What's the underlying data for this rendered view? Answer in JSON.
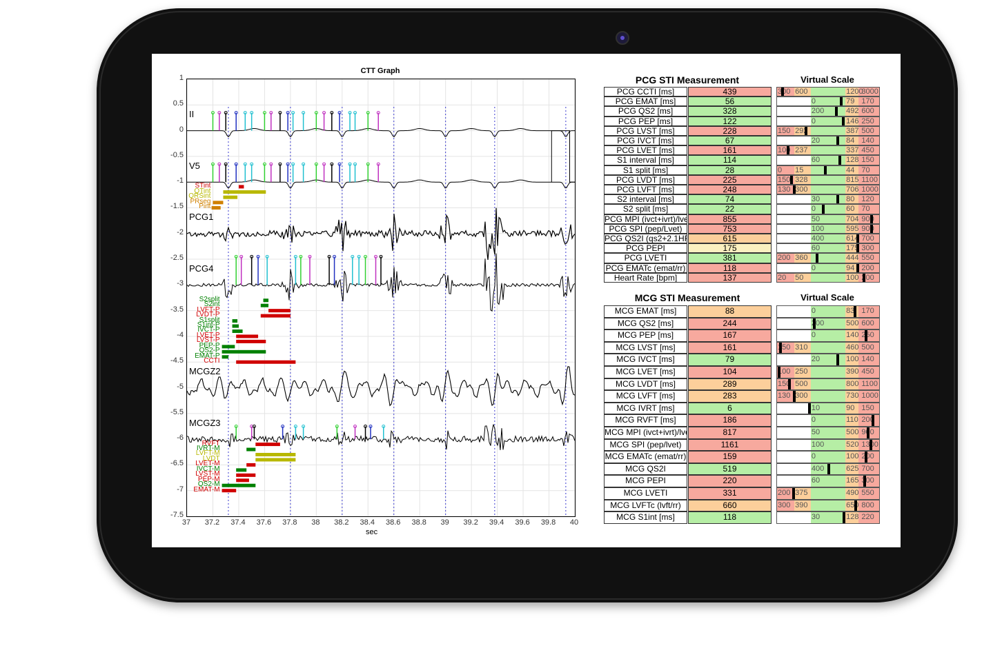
{
  "graph": {
    "title": "CTT Graph",
    "xlabel": "sec",
    "yticks": [
      "1",
      "0.5",
      "0",
      "-0.5",
      "-1",
      "-1.5",
      "-2",
      "-2.5",
      "-3",
      "-3.5",
      "-4",
      "-4.5",
      "-5",
      "-5.5",
      "-6",
      "-6.5",
      "-7",
      "-7.5"
    ],
    "xticks": [
      "37",
      "37.2",
      "37.4",
      "37.6",
      "37.8",
      "38",
      "38.2",
      "38.4",
      "38.6",
      "38.8",
      "39",
      "39.2",
      "39.4",
      "39.6",
      "39.8",
      "40"
    ],
    "signals": [
      "II",
      "V5",
      "PCG1",
      "PCG4",
      "MCGZ2",
      "MCGZ3"
    ],
    "ecg_markers": [
      "Pon",
      "Poff",
      "QRS",
      "Tp",
      "Toff",
      "Ton"
    ],
    "pcg_markers": [
      "S1",
      "S2",
      "S1s",
      "S2s",
      "S2p"
    ],
    "ecg_intervals": [
      {
        "label": "STint",
        "color": "#d00000"
      },
      {
        "label": "QTint",
        "color": "#b8b800"
      },
      {
        "label": "QRSint",
        "color": "#b8b800"
      },
      {
        "label": "PRseg",
        "color": "#d08000"
      },
      {
        "label": "Pint",
        "color": "#d08000"
      }
    ],
    "pcg_intervals": [
      {
        "label": "S2split",
        "color": "#008000"
      },
      {
        "label": "S2int",
        "color": "#008000"
      },
      {
        "label": "LVFT-P",
        "color": "#d00000"
      },
      {
        "label": "LVDT-P",
        "color": "#d00000"
      },
      {
        "label": "S1split",
        "color": "#008000"
      },
      {
        "label": "S1int-P",
        "color": "#008000"
      },
      {
        "label": "IVCT-P",
        "color": "#008000"
      },
      {
        "label": "LVET-P",
        "color": "#d00000"
      },
      {
        "label": "LVST-P",
        "color": "#d00000"
      },
      {
        "label": "PEP-P",
        "color": "#008000"
      },
      {
        "label": "QS2-P",
        "color": "#008000"
      },
      {
        "label": "EMAT-P",
        "color": "#008000"
      },
      {
        "label": "CCTI",
        "color": "#d00000"
      }
    ],
    "mcg_intervals": [
      {
        "label": "RVFT",
        "color": "#d00000"
      },
      {
        "label": "IVRT-M",
        "color": "#008000"
      },
      {
        "label": "LVFT-M",
        "color": "#b8b800"
      },
      {
        "label": "LVDT",
        "color": "#b8b800"
      },
      {
        "label": "LVET-M",
        "color": "#d00000"
      },
      {
        "label": "IVCT-M",
        "color": "#008000"
      },
      {
        "label": "LVST-M",
        "color": "#d00000"
      },
      {
        "label": "PEP-M",
        "color": "#d00000"
      },
      {
        "label": "QS2-M",
        "color": "#008000"
      },
      {
        "label": "EMAT-M",
        "color": "#d00000"
      }
    ],
    "mcg_markers": [
      "MC",
      "AO",
      "Ton",
      "AC",
      "MO"
    ]
  },
  "pcg_table": {
    "title": "PCG STI Measurement",
    "scale_title": "Virtual Scale",
    "rows": [
      {
        "name": "PCG CCTI [ms]",
        "value": "439",
        "color": "#f7a99e",
        "labels": [
          "300",
          "600",
          "1200",
          "3000"
        ],
        "marker": 0.04
      },
      {
        "name": "PCG EMAT [ms]",
        "value": "56",
        "color": "#b6eea5",
        "labels": [
          "0",
          "79",
          "170"
        ],
        "marker": 0.63
      },
      {
        "name": "PCG QS2 [ms]",
        "value": "328",
        "color": "#b6eea5",
        "labels": [
          "200",
          "492",
          "600"
        ],
        "marker": 0.58
      },
      {
        "name": "PCG PEP [ms]",
        "value": "122",
        "color": "#b6eea5",
        "labels": [
          "0",
          "146",
          "250"
        ],
        "marker": 0.65
      },
      {
        "name": "PCG LVST [ms]",
        "value": "228",
        "color": "#f7a99e",
        "labels": [
          "150",
          "292",
          "387",
          "500"
        ],
        "marker": 0.28
      },
      {
        "name": "PCG IVCT [ms]",
        "value": "67",
        "color": "#b6eea5",
        "labels": [
          "20",
          "84",
          "140"
        ],
        "marker": 0.6
      },
      {
        "name": "PCG LVET [ms]",
        "value": "161",
        "color": "#f7a99e",
        "labels": [
          "100",
          "237",
          "337",
          "450"
        ],
        "marker": 0.1
      },
      {
        "name": "S1 interval [ms]",
        "value": "114",
        "color": "#b6eea5",
        "labels": [
          "60",
          "128",
          "150"
        ],
        "marker": 0.62
      },
      {
        "name": "S1 split [ms]",
        "value": "28",
        "color": "#b6eea5",
        "labels": [
          "0",
          "15",
          "44",
          "70"
        ],
        "marker": 0.47
      },
      {
        "name": "PCG LVDT [ms]",
        "value": "225",
        "color": "#f7a99e",
        "labels": [
          "150",
          "328",
          "815",
          "1100"
        ],
        "marker": 0.13
      },
      {
        "name": "PCG LVFT [ms]",
        "value": "248",
        "color": "#f7a99e",
        "labels": [
          "130",
          "300",
          "706",
          "1000"
        ],
        "marker": 0.16
      },
      {
        "name": "S2 interval [ms]",
        "value": "74",
        "color": "#b6eea5",
        "labels": [
          "30",
          "80",
          "120"
        ],
        "marker": 0.6
      },
      {
        "name": "S2 split [ms]",
        "value": "22",
        "color": "#b6eea5",
        "labels": [
          "0",
          "60",
          "70"
        ],
        "marker": 0.45
      },
      {
        "name": "PCG MPI (ivct+ivrt)/lvet",
        "value": "855",
        "color": "#f7a99e",
        "labels": [
          "50",
          "704",
          "900"
        ],
        "marker": 0.94
      },
      {
        "name": "PCG SPI (pep/Lvet)",
        "value": "753",
        "color": "#f7a99e",
        "labels": [
          "100",
          "595",
          "900"
        ],
        "marker": 0.94
      },
      {
        "name": "PCG QS2I (qs2+2.1HR)",
        "value": "615",
        "color": "#fccf9b",
        "labels": [
          "400",
          "614",
          "700"
        ],
        "marker": 0.8
      },
      {
        "name": "PCG PEPI",
        "value": "175",
        "color": "#faf0c0",
        "labels": [
          "60",
          "175",
          "300"
        ],
        "marker": 0.8
      },
      {
        "name": "PCG LVETI",
        "value": "381",
        "color": "#b6eea5",
        "labels": [
          "200",
          "360",
          "444",
          "550"
        ],
        "marker": 0.39
      },
      {
        "name": "PCG EMATc (emat/rr)",
        "value": "118",
        "color": "#f7a99e",
        "labels": [
          "0",
          "94",
          "200"
        ],
        "marker": 0.8
      },
      {
        "name": "Heart Rate [bpm]",
        "value": "137",
        "color": "#f7a99e",
        "labels": [
          "20",
          "50",
          "100",
          "200"
        ],
        "marker": 0.86
      }
    ]
  },
  "mcg_table": {
    "title": "MCG STI Measurement",
    "scale_title": "Virtual Scale",
    "rows": [
      {
        "name": "MCG EMAT [ms]",
        "value": "88",
        "color": "#fccf9b",
        "labels": [
          "0",
          "83",
          "170"
        ],
        "marker": 0.77
      },
      {
        "name": "MCG QS2 [ms]",
        "value": "244",
        "color": "#f7a99e",
        "labels": [
          "200",
          "500",
          "600"
        ],
        "marker": 0.36
      },
      {
        "name": "MCG PEP [ms]",
        "value": "167",
        "color": "#f7a99e",
        "labels": [
          "0",
          "140",
          "250"
        ],
        "marker": 0.88
      },
      {
        "name": "MCG LVST [ms]",
        "value": "161",
        "color": "#f7a99e",
        "labels": [
          "150",
          "310",
          "460",
          "500"
        ],
        "marker": 0.02
      },
      {
        "name": "MCG IVCT [ms]",
        "value": "79",
        "color": "#b6eea5",
        "labels": [
          "20",
          "100",
          "140"
        ],
        "marker": 0.6
      },
      {
        "name": "MCG LVET [ms]",
        "value": "104",
        "color": "#f7a99e",
        "labels": [
          "100",
          "250",
          "390",
          "450"
        ],
        "marker": 0.01
      },
      {
        "name": "MCG LVDT [ms]",
        "value": "289",
        "color": "#fccf9b",
        "labels": [
          "150",
          "500",
          "800",
          "1100"
        ],
        "marker": 0.11
      },
      {
        "name": "MCG LVFT [ms]",
        "value": "283",
        "color": "#fccf9b",
        "labels": [
          "130",
          "300",
          "730",
          "1000"
        ],
        "marker": 0.16
      },
      {
        "name": "MCG IVRT [ms]",
        "value": "6",
        "color": "#b6eea5",
        "labels": [
          "10",
          "90",
          "150"
        ],
        "marker": 0.31
      },
      {
        "name": "MCG RVFT [ms]",
        "value": "186",
        "color": "#f7a99e",
        "labels": [
          "0",
          "110",
          "200"
        ],
        "marker": 0.95
      },
      {
        "name": "MCG MPI (ivct+ivrt)/lvet",
        "value": "817",
        "color": "#f7a99e",
        "labels": [
          "50",
          "500",
          "900"
        ],
        "marker": 0.9
      },
      {
        "name": "MCG SPI (pep/lvet)",
        "value": "1161",
        "color": "#f7a99e",
        "labels": [
          "100",
          "520",
          "1300"
        ],
        "marker": 0.93
      },
      {
        "name": "MCG EMATc (emat/rr)",
        "value": "159",
        "color": "#f7a99e",
        "labels": [
          "0",
          "100",
          "200"
        ],
        "marker": 0.88
      },
      {
        "name": "MCG QS2I",
        "value": "519",
        "color": "#b6eea5",
        "labels": [
          "400",
          "625",
          "700"
        ],
        "marker": 0.51
      },
      {
        "name": "MCG PEPI",
        "value": "220",
        "color": "#f7a99e",
        "labels": [
          "60",
          "165",
          "300"
        ],
        "marker": 0.87
      },
      {
        "name": "MCG LVETI",
        "value": "331",
        "color": "#f7a99e",
        "labels": [
          "200",
          "375",
          "490",
          "550"
        ],
        "marker": 0.15
      },
      {
        "name": "MCG LVFTc (lvft/rr)",
        "value": "660",
        "color": "#fccf9b",
        "labels": [
          "300",
          "390",
          "650",
          "800"
        ],
        "marker": 0.78
      },
      {
        "name": "MCG S1int [ms]",
        "value": "118",
        "color": "#b6eea5",
        "labels": [
          "30",
          "128",
          "220"
        ],
        "marker": 0.66
      }
    ]
  },
  "colors": {
    "green": "#b6eea5",
    "red": "#f7a99e",
    "orange": "#fccf9b",
    "yellow": "#faf0c0",
    "bezel": "#111111"
  }
}
